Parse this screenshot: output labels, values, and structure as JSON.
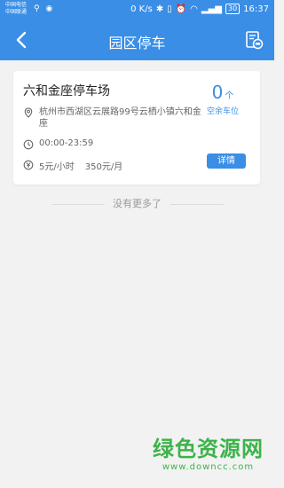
{
  "statusbar": {
    "carrier_line1": "中国电信",
    "carrier_line2": "中国联通",
    "network_speed": "0 K/s",
    "battery": "30",
    "time": "16:37"
  },
  "navbar": {
    "title": "园区停车"
  },
  "card": {
    "lot_name": "六和金座停车场",
    "spaces_count": "0",
    "spaces_unit": "个",
    "spaces_label": "空余车位",
    "address": "杭州市西湖区云展路99号云栖小镇六和金座",
    "hours": "00:00-23:59",
    "price_hourly": "5元/小时",
    "price_monthly": "350元/月",
    "detail_button": "详情"
  },
  "footer": {
    "no_more": "没有更多了"
  },
  "watermark": {
    "main": "绿色资源网",
    "sub": "www.downcc.com"
  },
  "colors": {
    "primary": "#3a8ee6",
    "background": "#f2f2f2",
    "watermark": "#3db34a"
  }
}
